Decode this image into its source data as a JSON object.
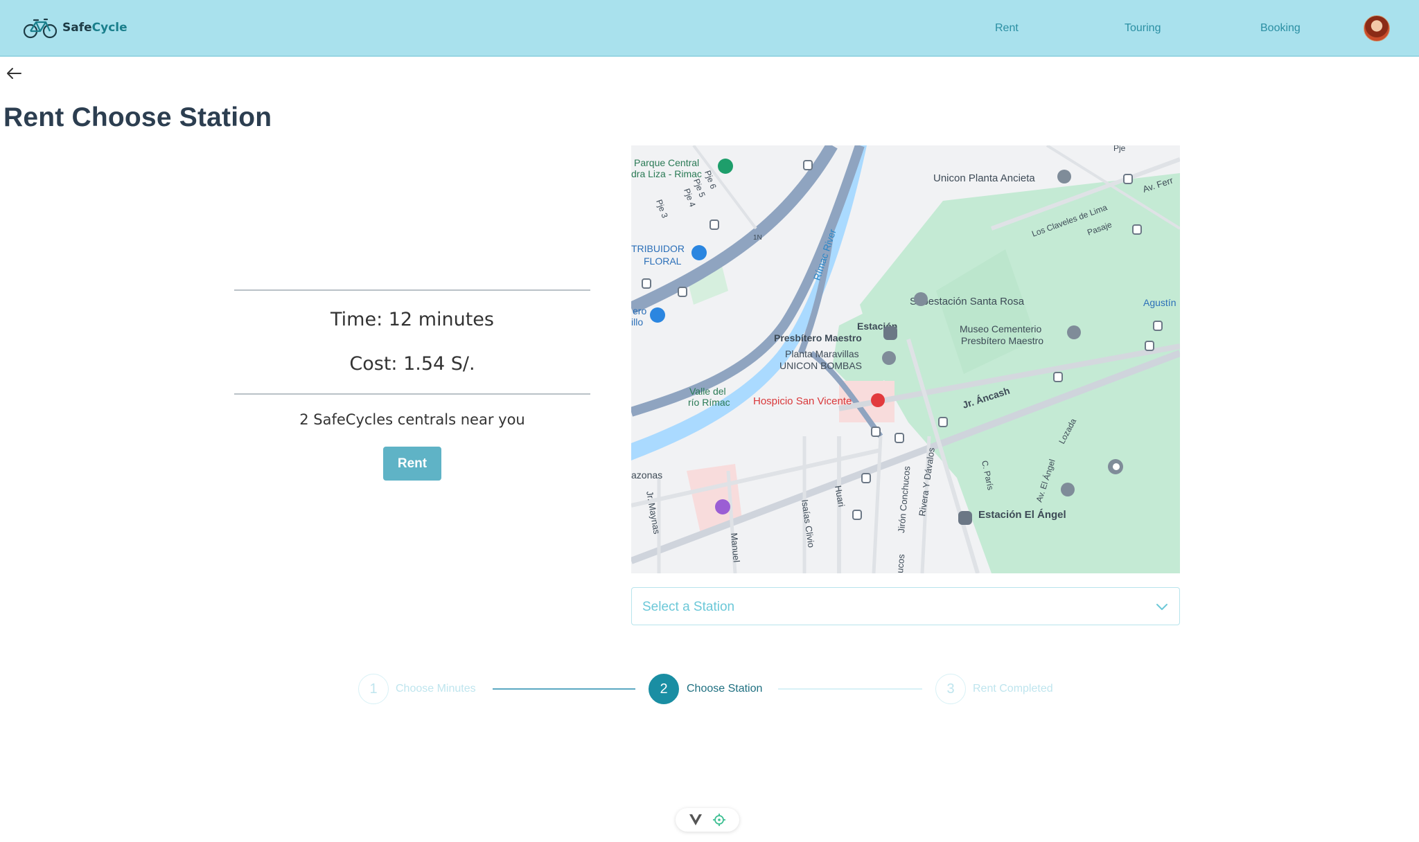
{
  "header": {
    "brand_prefix": "Safe",
    "brand_suffix": "Cycle",
    "nav": [
      {
        "label": "Rent"
      },
      {
        "label": "Touring"
      },
      {
        "label": "Booking"
      }
    ]
  },
  "page": {
    "title": "Rent Choose Station"
  },
  "summary": {
    "time_text": "Time: 12 minutes",
    "cost_text": "Cost: 1.54 S/.",
    "centrals_text": "2 SafeCycles centrals near you",
    "rent_button": "Rent"
  },
  "map": {
    "labels": {
      "parque": "Parque Central",
      "parque2": "dra Liza - Rimac",
      "unicon": "Unicon Planta Ancieta",
      "av_fer": "Av. Ferr",
      "claveles": "Los Claveles de Lima",
      "pasaje": "Pasaje",
      "tribuidor": "TRIBUIDOR",
      "floral": "FLORAL",
      "rimac_river": "Rímac River",
      "subestacion": "Subestación Santa Rosa",
      "agustin": "Agustín",
      "estacion_pm1": "Estación",
      "estacion_pm2": "Presbítero Maestro",
      "museo1": "Museo Cementerio",
      "museo2": "Presbítero Maestro",
      "planta1": "Planta Maravillas",
      "planta2": "UNICON BOMBAS",
      "valle1": "Valle del",
      "valle2": "río Rímac",
      "hospicio": "Hospicio San Vicente",
      "ancash": "Jr. Áncash",
      "lozada": "Lozada",
      "azonas": "azonas",
      "maynas": "Jr. Maynas",
      "manuel": "Manuel",
      "isaias": "Isaías Clivio",
      "huari": "Huari",
      "conchucos": "Jirón Conchucos",
      "rivera": "Rivera Y Dávalos",
      "cparis": "C. París",
      "elangel_av": "Av. El Ángel",
      "estacion_angel": "Estación El Ángel",
      "ucos": "ucos",
      "ero": "ero",
      "illo": "illo",
      "pje3": "Pje 3",
      "pje4": "Pje 4",
      "pje5": "Pje 5",
      "pje6": "Pje 6",
      "ie": "1N",
      "pje_top": "Pje"
    }
  },
  "station_select": {
    "placeholder": "Select a Station"
  },
  "stepper": {
    "steps": [
      {
        "number": "1",
        "label": "Choose Minutes",
        "state": "inactive"
      },
      {
        "number": "2",
        "label": "Choose Station",
        "state": "active"
      },
      {
        "number": "3",
        "label": "Rent Completed",
        "state": "inactive"
      }
    ]
  },
  "colors": {
    "header_bg": "#a9e1ed",
    "nav_link": "#2b8fa3",
    "accent": "#1a8ea3",
    "button": "#5fb3c6",
    "park_green": "#c4ead4",
    "river": "#aadaff",
    "highway": "#8fa4c0"
  }
}
